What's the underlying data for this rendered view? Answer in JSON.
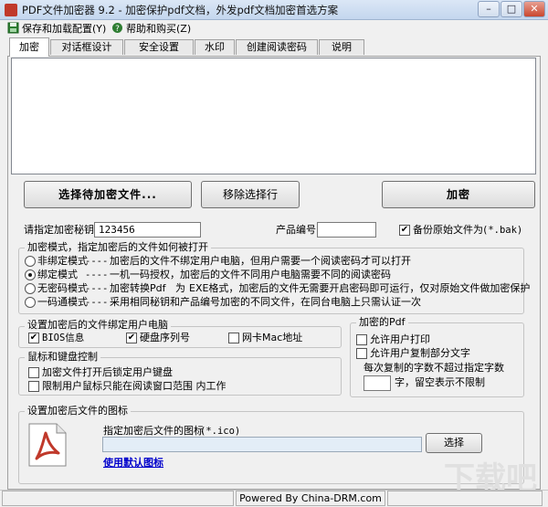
{
  "window": {
    "title": "PDF文件加密器 9.2 - 加密保护pdf文档，外发pdf文档加密首选方案",
    "btn_min": "–",
    "btn_max": "□",
    "btn_close": "✕"
  },
  "menu": {
    "save_load": "保存和加载配置(Y)",
    "help_buy": "帮助和购买(Z)"
  },
  "tabs": [
    "加密",
    "对话框设计",
    "安全设置",
    "水印",
    "创建阅读密码",
    "说明"
  ],
  "buttons": {
    "select_files": "选择待加密文件...",
    "remove_selected": "移除选择行",
    "encrypt": "加密",
    "choose_icon": "选择"
  },
  "key": {
    "label": "请指定加密秘钥",
    "value": "123456"
  },
  "product": {
    "label": "产品编号",
    "value": ""
  },
  "backup": {
    "checked": true,
    "label": "备份原始文件为",
    "ext": "(*.bak)"
  },
  "mode_group": {
    "title": "加密模式，指定加密后的文件如何被打开",
    "options": [
      {
        "name": "非绑定模式",
        "sep": "----",
        "desc": "加密后的文件不绑定用户电脑，但用户需要一个阅读密码才可以打开",
        "selected": false
      },
      {
        "name": "绑定模式",
        "sep": "----",
        "desc": "一机一码授权，加密后的文件不同用户电脑需要不同的阅读密码",
        "selected": true
      },
      {
        "name": "无密码模式",
        "sep": "----",
        "desc_a": "加密转换Pdf",
        "desc_b": "为",
        "desc_c": "EXE格式，加密后的文件无需要开启密码即可运行，仅对原始文件做加密保护",
        "selected": false
      },
      {
        "name": "一码通模式",
        "sep": "----",
        "desc": "采用相同秘钥和产品编号加密的不同文件，在同台电脑上只需认证一次",
        "selected": false
      }
    ]
  },
  "bind_group": {
    "title": "设置加密后的文件绑定用户电脑",
    "items": [
      {
        "label": "BIOS信息",
        "checked": true
      },
      {
        "label": "硬盘序列号",
        "checked": true
      },
      {
        "label": "网卡Mac地址",
        "checked": false
      }
    ]
  },
  "pdf_group": {
    "title": "加密的Pdf",
    "allow_print": {
      "label": "允许用户打印",
      "checked": false
    },
    "allow_copy": {
      "label": "允许用户复制部分文字",
      "checked": false
    },
    "max_chars_label": "每次复制的字数不超过指定字数",
    "max_chars_value": "",
    "max_chars_suffix": "字，留空表示不限制"
  },
  "mouse_group": {
    "title": "鼠标和键盘控制",
    "items": [
      {
        "label": "加密文件打开后锁定用户键盘",
        "checked": false
      },
      {
        "label": "限制用户鼠标只能在阅读窗口范围 内工作",
        "checked": false
      }
    ]
  },
  "icon_group": {
    "title": "设置加密后文件的图标",
    "path_label": "指定加密后文件的图标",
    "path_ext": "(*.ico)",
    "path_value": "",
    "default_link": "使用默认图标"
  },
  "status": {
    "powered_by": "Powered By China-DRM.com"
  },
  "watermark": "下载吧",
  "colors": {
    "pdf_icon_red": "#c0392b",
    "link_blue": "#0000cc"
  }
}
